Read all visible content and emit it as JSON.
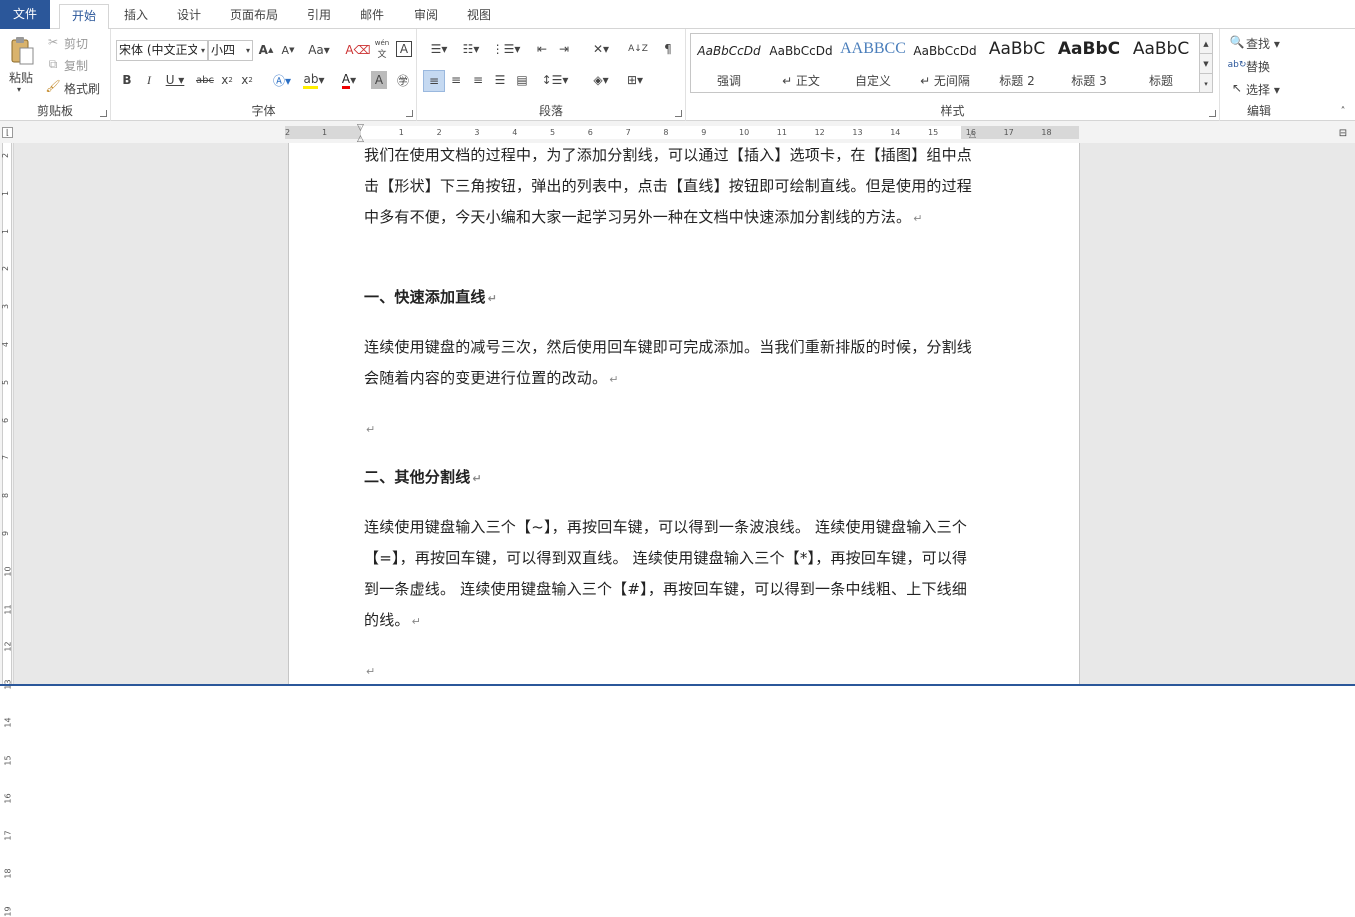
{
  "tabs": {
    "file": "文件",
    "home": "开始",
    "insert": "插入",
    "design": "设计",
    "layout": "页面布局",
    "references": "引用",
    "mailings": "邮件",
    "review": "审阅",
    "view": "视图"
  },
  "clipboard": {
    "label": "剪贴板",
    "paste": "粘贴",
    "cut": "剪切",
    "copy": "复制",
    "format_painter": "格式刷"
  },
  "font": {
    "label": "字体",
    "font_name": "宋体 (中文正文)",
    "font_size": "小四",
    "phonetic": "wén"
  },
  "paragraph": {
    "label": "段落"
  },
  "styles": {
    "label": "样式",
    "items": [
      {
        "sample": "AaBbCcDd",
        "name": "强调"
      },
      {
        "sample": "AaBbCcDd",
        "name": "↵ 正文"
      },
      {
        "sample": "AABBCC",
        "name": "自定义"
      },
      {
        "sample": "AaBbCcDd",
        "name": "↵ 无间隔"
      },
      {
        "sample": "AaBbC",
        "name": "标题 2"
      },
      {
        "sample": "AaBbC",
        "name": "标题 3"
      },
      {
        "sample": "AaBbC",
        "name": "标题"
      }
    ]
  },
  "editing": {
    "label": "编辑",
    "find": "查找",
    "replace": "替换",
    "select": "选择"
  },
  "ruler": {
    "h_numbers": [
      "2",
      "1",
      "1",
      "2",
      "3",
      "4",
      "5",
      "6",
      "7",
      "8",
      "9",
      "10",
      "11",
      "12",
      "13",
      "14",
      "15",
      "16",
      "17",
      "18"
    ],
    "v_numbers": [
      "2",
      "1",
      "1",
      "2",
      "3",
      "4",
      "5",
      "6",
      "7",
      "8",
      "9",
      "10",
      "11",
      "12",
      "13",
      "14",
      "15",
      "16",
      "17",
      "18",
      "19"
    ]
  },
  "document": {
    "p1": "我们在使用文档的过程中，为了添加分割线，可以通过【插入】选项卡，在【插图】组中点击【形状】下三角按钮，弹出的列表中，点击【直线】按钮即可绘制直线。但是使用的过程中多有不便，今天小编和大家一起学习另外一种在文档中快速添加分割线的方法。",
    "h1": "一、快速添加直线",
    "p2": "连续使用键盘的减号三次，然后使用回车键即可完成添加。当我们重新排版的时候，分割线会随着内容的变更进行位置的改动。",
    "h2": "二、其他分割线",
    "p3": "连续使用键盘输入三个【~】，再按回车键，可以得到一条波浪线。 连续使用键盘输入三个【=】，再按回车键，可以得到双直线。 连续使用键盘输入三个【*】，再按回车键，可以得到一条虚线。 连续使用键盘输入三个【#】，再按回车键，可以得到一条中线粗、上下线细的线。",
    "para_mark": "↵"
  }
}
